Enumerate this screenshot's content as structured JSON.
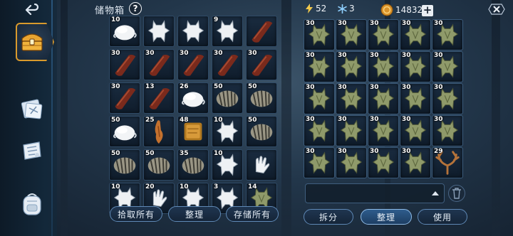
{
  "storage": {
    "title": "储物箱",
    "help_icon": "help-icon",
    "slots": [
      {
        "qty": "10",
        "item": "white-fur"
      },
      {
        "qty": "",
        "item": "wolf-pelt"
      },
      {
        "qty": "",
        "item": "wolf-pelt"
      },
      {
        "qty": "9",
        "item": "wolf-pelt"
      },
      {
        "qty": "",
        "item": "leather-strip"
      },
      {
        "qty": "30",
        "item": "leather-strip"
      },
      {
        "qty": "30",
        "item": "leather-strip"
      },
      {
        "qty": "30",
        "item": "leather-strip"
      },
      {
        "qty": "30",
        "item": "leather-strip"
      },
      {
        "qty": "30",
        "item": "leather-strip"
      },
      {
        "qty": "30",
        "item": "leather-strip"
      },
      {
        "qty": "13",
        "item": "leather-strip"
      },
      {
        "qty": "26",
        "item": "white-fur"
      },
      {
        "qty": "50",
        "item": "striped-fur"
      },
      {
        "qty": "50",
        "item": "striped-fur"
      },
      {
        "qty": "50",
        "item": "white-fur"
      },
      {
        "qty": "25",
        "item": "rabbit-pelt"
      },
      {
        "qty": "48",
        "item": "hide-scrap"
      },
      {
        "qty": "10",
        "item": "wolf-pelt"
      },
      {
        "qty": "50",
        "item": "striped-fur"
      },
      {
        "qty": "50",
        "item": "striped-fur"
      },
      {
        "qty": "50",
        "item": "striped-fur"
      },
      {
        "qty": "35",
        "item": "striped-fur"
      },
      {
        "qty": "10",
        "item": "wolf-pelt"
      },
      {
        "qty": "",
        "item": "white-glove"
      },
      {
        "qty": "10",
        "item": "wolf-pelt"
      },
      {
        "qty": "20",
        "item": "white-glove"
      },
      {
        "qty": "10",
        "item": "wolf-pelt"
      },
      {
        "qty": "3",
        "item": "wolf-pelt"
      },
      {
        "qty": "14",
        "item": "green-pelt"
      }
    ],
    "buttons": {
      "take_all": "拾取所有",
      "sort": "整理",
      "store_all": "存储所有"
    }
  },
  "resources": {
    "energy": "52",
    "snowflake": "3",
    "coins": "14832",
    "energy_icon": "lightning-icon",
    "snow_icon": "snowflake-icon",
    "coin_icon": "coin-icon",
    "plus_icon": "plus-icon"
  },
  "inventory": {
    "slots": [
      {
        "qty": "30",
        "item": "green-pelt"
      },
      {
        "qty": "30",
        "item": "green-pelt"
      },
      {
        "qty": "30",
        "item": "green-pelt"
      },
      {
        "qty": "30",
        "item": "green-pelt"
      },
      {
        "qty": "30",
        "item": "green-pelt"
      },
      {
        "qty": "30",
        "item": "green-pelt"
      },
      {
        "qty": "30",
        "item": "green-pelt"
      },
      {
        "qty": "30",
        "item": "green-pelt"
      },
      {
        "qty": "30",
        "item": "green-pelt"
      },
      {
        "qty": "30",
        "item": "green-pelt"
      },
      {
        "qty": "30",
        "item": "green-pelt"
      },
      {
        "qty": "30",
        "item": "green-pelt"
      },
      {
        "qty": "30",
        "item": "green-pelt"
      },
      {
        "qty": "30",
        "item": "green-pelt"
      },
      {
        "qty": "30",
        "item": "green-pelt"
      },
      {
        "qty": "30",
        "item": "green-pelt"
      },
      {
        "qty": "30",
        "item": "green-pelt"
      },
      {
        "qty": "30",
        "item": "green-pelt"
      },
      {
        "qty": "30",
        "item": "green-pelt"
      },
      {
        "qty": "30",
        "item": "green-pelt"
      },
      {
        "qty": "30",
        "item": "green-pelt"
      },
      {
        "qty": "30",
        "item": "green-pelt"
      },
      {
        "qty": "30",
        "item": "green-pelt"
      },
      {
        "qty": "30",
        "item": "green-pelt"
      },
      {
        "qty": "29",
        "item": "antlers"
      }
    ],
    "buttons": {
      "split": "拆分",
      "sort": "整理",
      "use": "使用"
    }
  },
  "sidebar": {
    "items": [
      {
        "icon": "back-arrow-icon"
      },
      {
        "icon": "treasure-chest-icon",
        "active": true
      },
      {
        "icon": "blueprint-icon"
      },
      {
        "icon": "scroll-map-icon"
      },
      {
        "icon": "backpack-icon"
      }
    ]
  },
  "colors": {
    "accent": "#d99a2c",
    "button_border": "#5f89b6",
    "coin": "#d9922a"
  }
}
